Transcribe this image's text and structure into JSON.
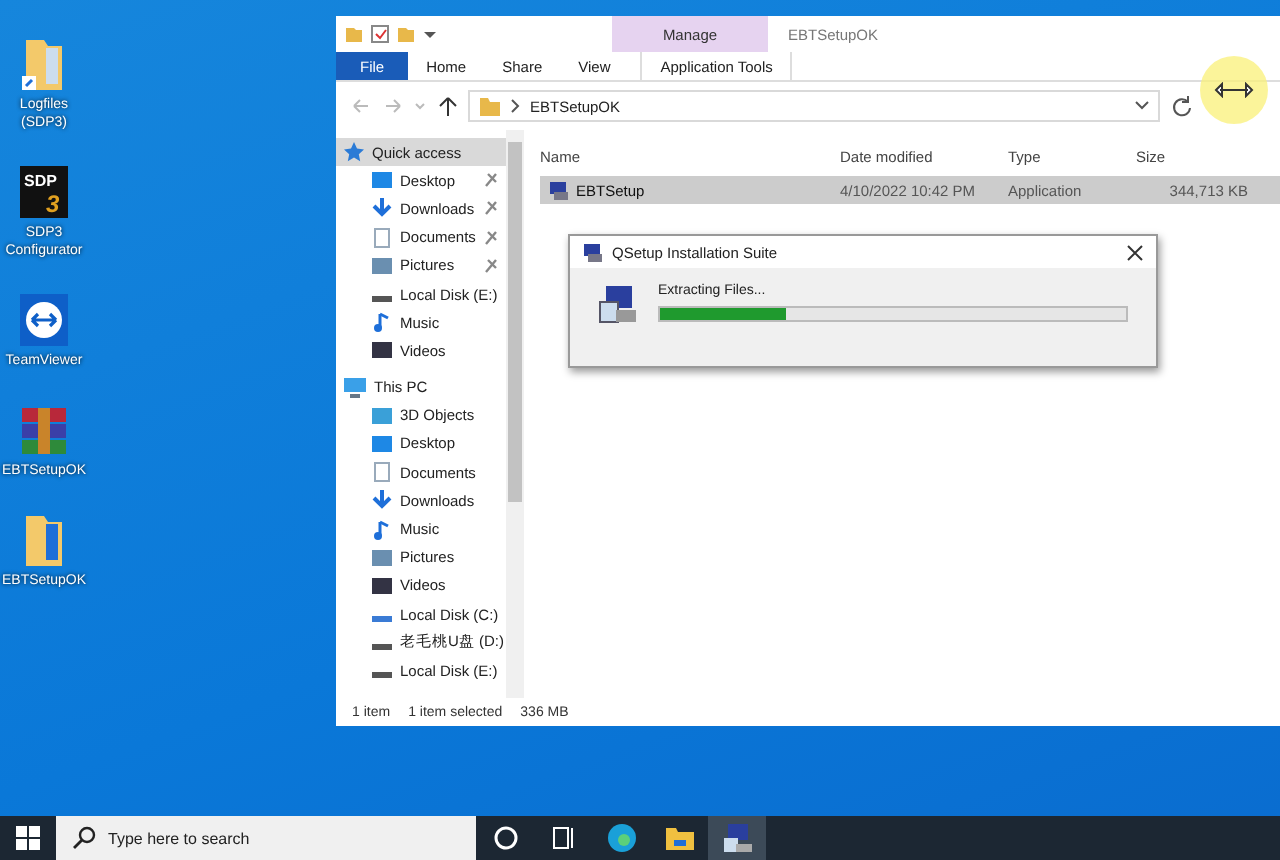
{
  "desktop_icons": [
    {
      "label": "Logfiles (SDP3)",
      "kind": "folder-shortcut"
    },
    {
      "label": "SDP3 Configurator",
      "kind": "sdp3",
      "logo_text": "SDP",
      "logo_digit": "3"
    },
    {
      "label": "TeamViewer",
      "kind": "teamviewer"
    },
    {
      "label": "EBTSetupOK",
      "kind": "archive"
    },
    {
      "label": "EBTSetupOK",
      "kind": "folder"
    }
  ],
  "explorer": {
    "title": "EBTSetupOK",
    "contextual_group": "Manage",
    "ribbon_tabs": [
      {
        "label": "File",
        "kind": "file",
        "selected": false
      },
      {
        "label": "Home",
        "kind": "normal",
        "selected": false
      },
      {
        "label": "Share",
        "kind": "normal",
        "selected": false
      },
      {
        "label": "View",
        "kind": "normal",
        "selected": false
      },
      {
        "label": "Application Tools",
        "kind": "contextual",
        "selected": false
      }
    ],
    "address": "EBTSetupOK",
    "nav": [
      {
        "label": "Quick access",
        "kind": "star",
        "selected": true,
        "children": [
          {
            "label": "Desktop",
            "kind": "desktop",
            "pinned": true
          },
          {
            "label": "Downloads",
            "kind": "download",
            "pinned": true
          },
          {
            "label": "Documents",
            "kind": "document",
            "pinned": true
          },
          {
            "label": "Pictures",
            "kind": "pictures",
            "pinned": true
          },
          {
            "label": "Local Disk (E:)",
            "kind": "drive",
            "pinned": false
          },
          {
            "label": "Music",
            "kind": "music",
            "pinned": false
          },
          {
            "label": "Videos",
            "kind": "videos",
            "pinned": false
          }
        ]
      },
      {
        "label": "This PC",
        "kind": "pc",
        "selected": false,
        "children": [
          {
            "label": "3D Objects",
            "kind": "objects",
            "pinned": false
          },
          {
            "label": "Desktop",
            "kind": "desktop",
            "pinned": false
          },
          {
            "label": "Documents",
            "kind": "document",
            "pinned": false
          },
          {
            "label": "Downloads",
            "kind": "download",
            "pinned": false
          },
          {
            "label": "Music",
            "kind": "music",
            "pinned": false
          },
          {
            "label": "Pictures",
            "kind": "pictures",
            "pinned": false
          },
          {
            "label": "Videos",
            "kind": "videos",
            "pinned": false
          },
          {
            "label": "Local Disk (C:)",
            "kind": "sysdrive",
            "pinned": false
          },
          {
            "label": "老毛桃U盘 (D:)",
            "kind": "drive",
            "pinned": false
          },
          {
            "label": "Local Disk (E:)",
            "kind": "drive",
            "pinned": false
          }
        ]
      }
    ],
    "columns": [
      "Name",
      "Date modified",
      "Type",
      "Size"
    ],
    "rows": [
      {
        "name": "EBTSetup",
        "date": "4/10/2022 10:42 PM",
        "type": "Application",
        "size": "344,713 KB",
        "selected": true
      }
    ],
    "status": {
      "count": "1 item",
      "selection": "1 item selected",
      "size": "336 MB"
    }
  },
  "dialog": {
    "title": "QSetup Installation Suite",
    "message": "Extracting Files...",
    "level": 0.27
  },
  "taskbar": {
    "search_placeholder": "Type here to search",
    "apps": [
      {
        "kind": "cortana",
        "selected": false
      },
      {
        "kind": "taskview",
        "selected": false
      },
      {
        "kind": "edge",
        "selected": false
      },
      {
        "kind": "explorer",
        "selected": false
      },
      {
        "kind": "setup",
        "selected": true
      }
    ]
  }
}
